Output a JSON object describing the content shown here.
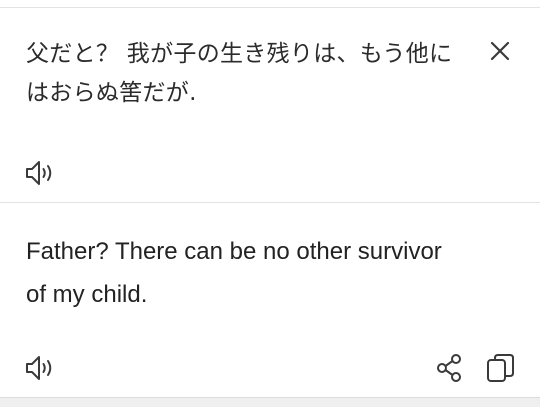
{
  "source": {
    "text": "父だと？ 我が子の生き残りは、もう他にはおらぬ筈だが.",
    "close_icon": "close-icon",
    "speaker_icon": "speaker-icon"
  },
  "translation": {
    "text": "Father? There can be no other survivor of my child.",
    "speaker_icon": "speaker-icon",
    "share_icon": "share-icon",
    "copy_icon": "copy-icon"
  },
  "colors": {
    "text": "#2b2b2b",
    "icon": "#3a3a3a",
    "divider": "#e3e3e3",
    "background": "#ffffff"
  }
}
